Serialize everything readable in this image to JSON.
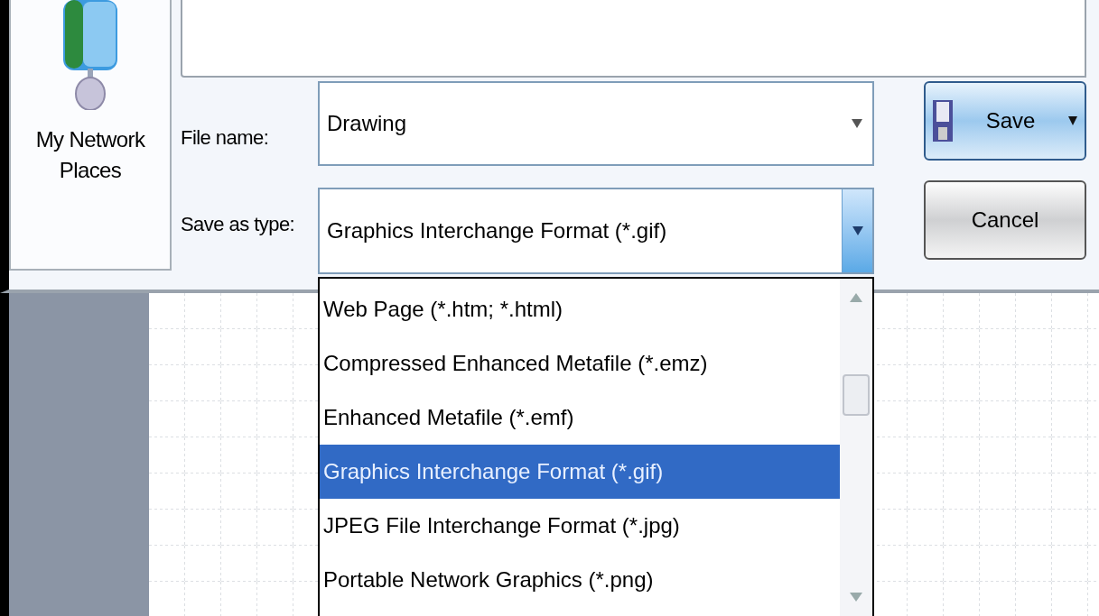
{
  "places": [
    {
      "label": "My Network Places",
      "selected": false
    }
  ],
  "file_name": {
    "label": "File name:",
    "value": "Drawing"
  },
  "save_as_type": {
    "label": "Save as type:",
    "value": "Graphics Interchange Format (*.gif)",
    "expanded": true
  },
  "type_options": [
    {
      "label": "Web Page (*.htm; *.html)",
      "selected": false
    },
    {
      "label": "Compressed Enhanced Metafile (*.emz)",
      "selected": false
    },
    {
      "label": "Enhanced Metafile (*.emf)",
      "selected": false
    },
    {
      "label": "Graphics Interchange Format (*.gif)",
      "selected": true
    },
    {
      "label": "JPEG File Interchange Format (*.jpg)",
      "selected": false
    },
    {
      "label": "Portable Network Graphics (*.png)",
      "selected": false
    }
  ],
  "buttons": [
    {
      "label": "Save",
      "kind": "primary"
    },
    {
      "label": "Cancel",
      "kind": "plain"
    }
  ]
}
